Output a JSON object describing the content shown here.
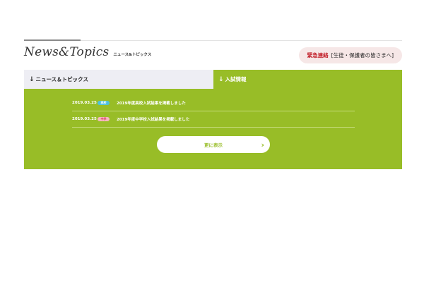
{
  "header": {
    "title": "News&Topics",
    "subtitle": "ニュース&トピックス"
  },
  "emergency": {
    "label": "緊急連絡",
    "text": "[生徒・保護者の皆さまへ]"
  },
  "tabs": [
    {
      "label": "ニュース＆トピックス",
      "arrow": "↓",
      "active": false
    },
    {
      "label": "入試情報",
      "arrow": "↓",
      "active": true
    }
  ],
  "news": [
    {
      "date": "2019.03.25",
      "badge": "高校",
      "title": "2019年度高校入試結果を掲載しました"
    },
    {
      "date": "2019.03.25",
      "badge": "中学",
      "title": "2019年度中学校入試結果を掲載しました"
    }
  ],
  "more": {
    "label": "更に表示",
    "icon": "chevron-right-icon"
  },
  "colors": {
    "panel": "#98bd27",
    "tab_inactive": "#eeeef4",
    "badge_high": "#4fc0dc",
    "badge_mid": "#f6b8c0",
    "emergency_bg": "#f6e7e7",
    "emergency_text": "#c2202a"
  }
}
